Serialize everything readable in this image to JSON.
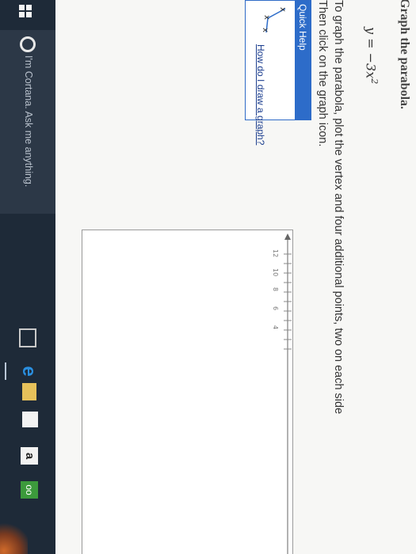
{
  "problem": {
    "title": "Graph the parabola.",
    "equation_lhs": "y = −3x",
    "equation_exponent": "2",
    "instruction_line1": "To graph the parabola, plot the vertex and four additional points, two on each side",
    "instruction_line2": "Then click on the graph icon."
  },
  "quick_help": {
    "header": "Quick Help",
    "link_text": "How do I draw a graph?"
  },
  "graph": {
    "y_tick_labels": [
      "12",
      "10",
      "8",
      "6",
      "4"
    ]
  },
  "taskbar": {
    "search_placeholder": "I'm Cortana. Ask me anything.",
    "amazon_label": "a",
    "tripadvisor_label": "oo"
  },
  "colors": {
    "quick_help_blue": "#2d6cc9",
    "taskbar": "#1e2a38"
  }
}
